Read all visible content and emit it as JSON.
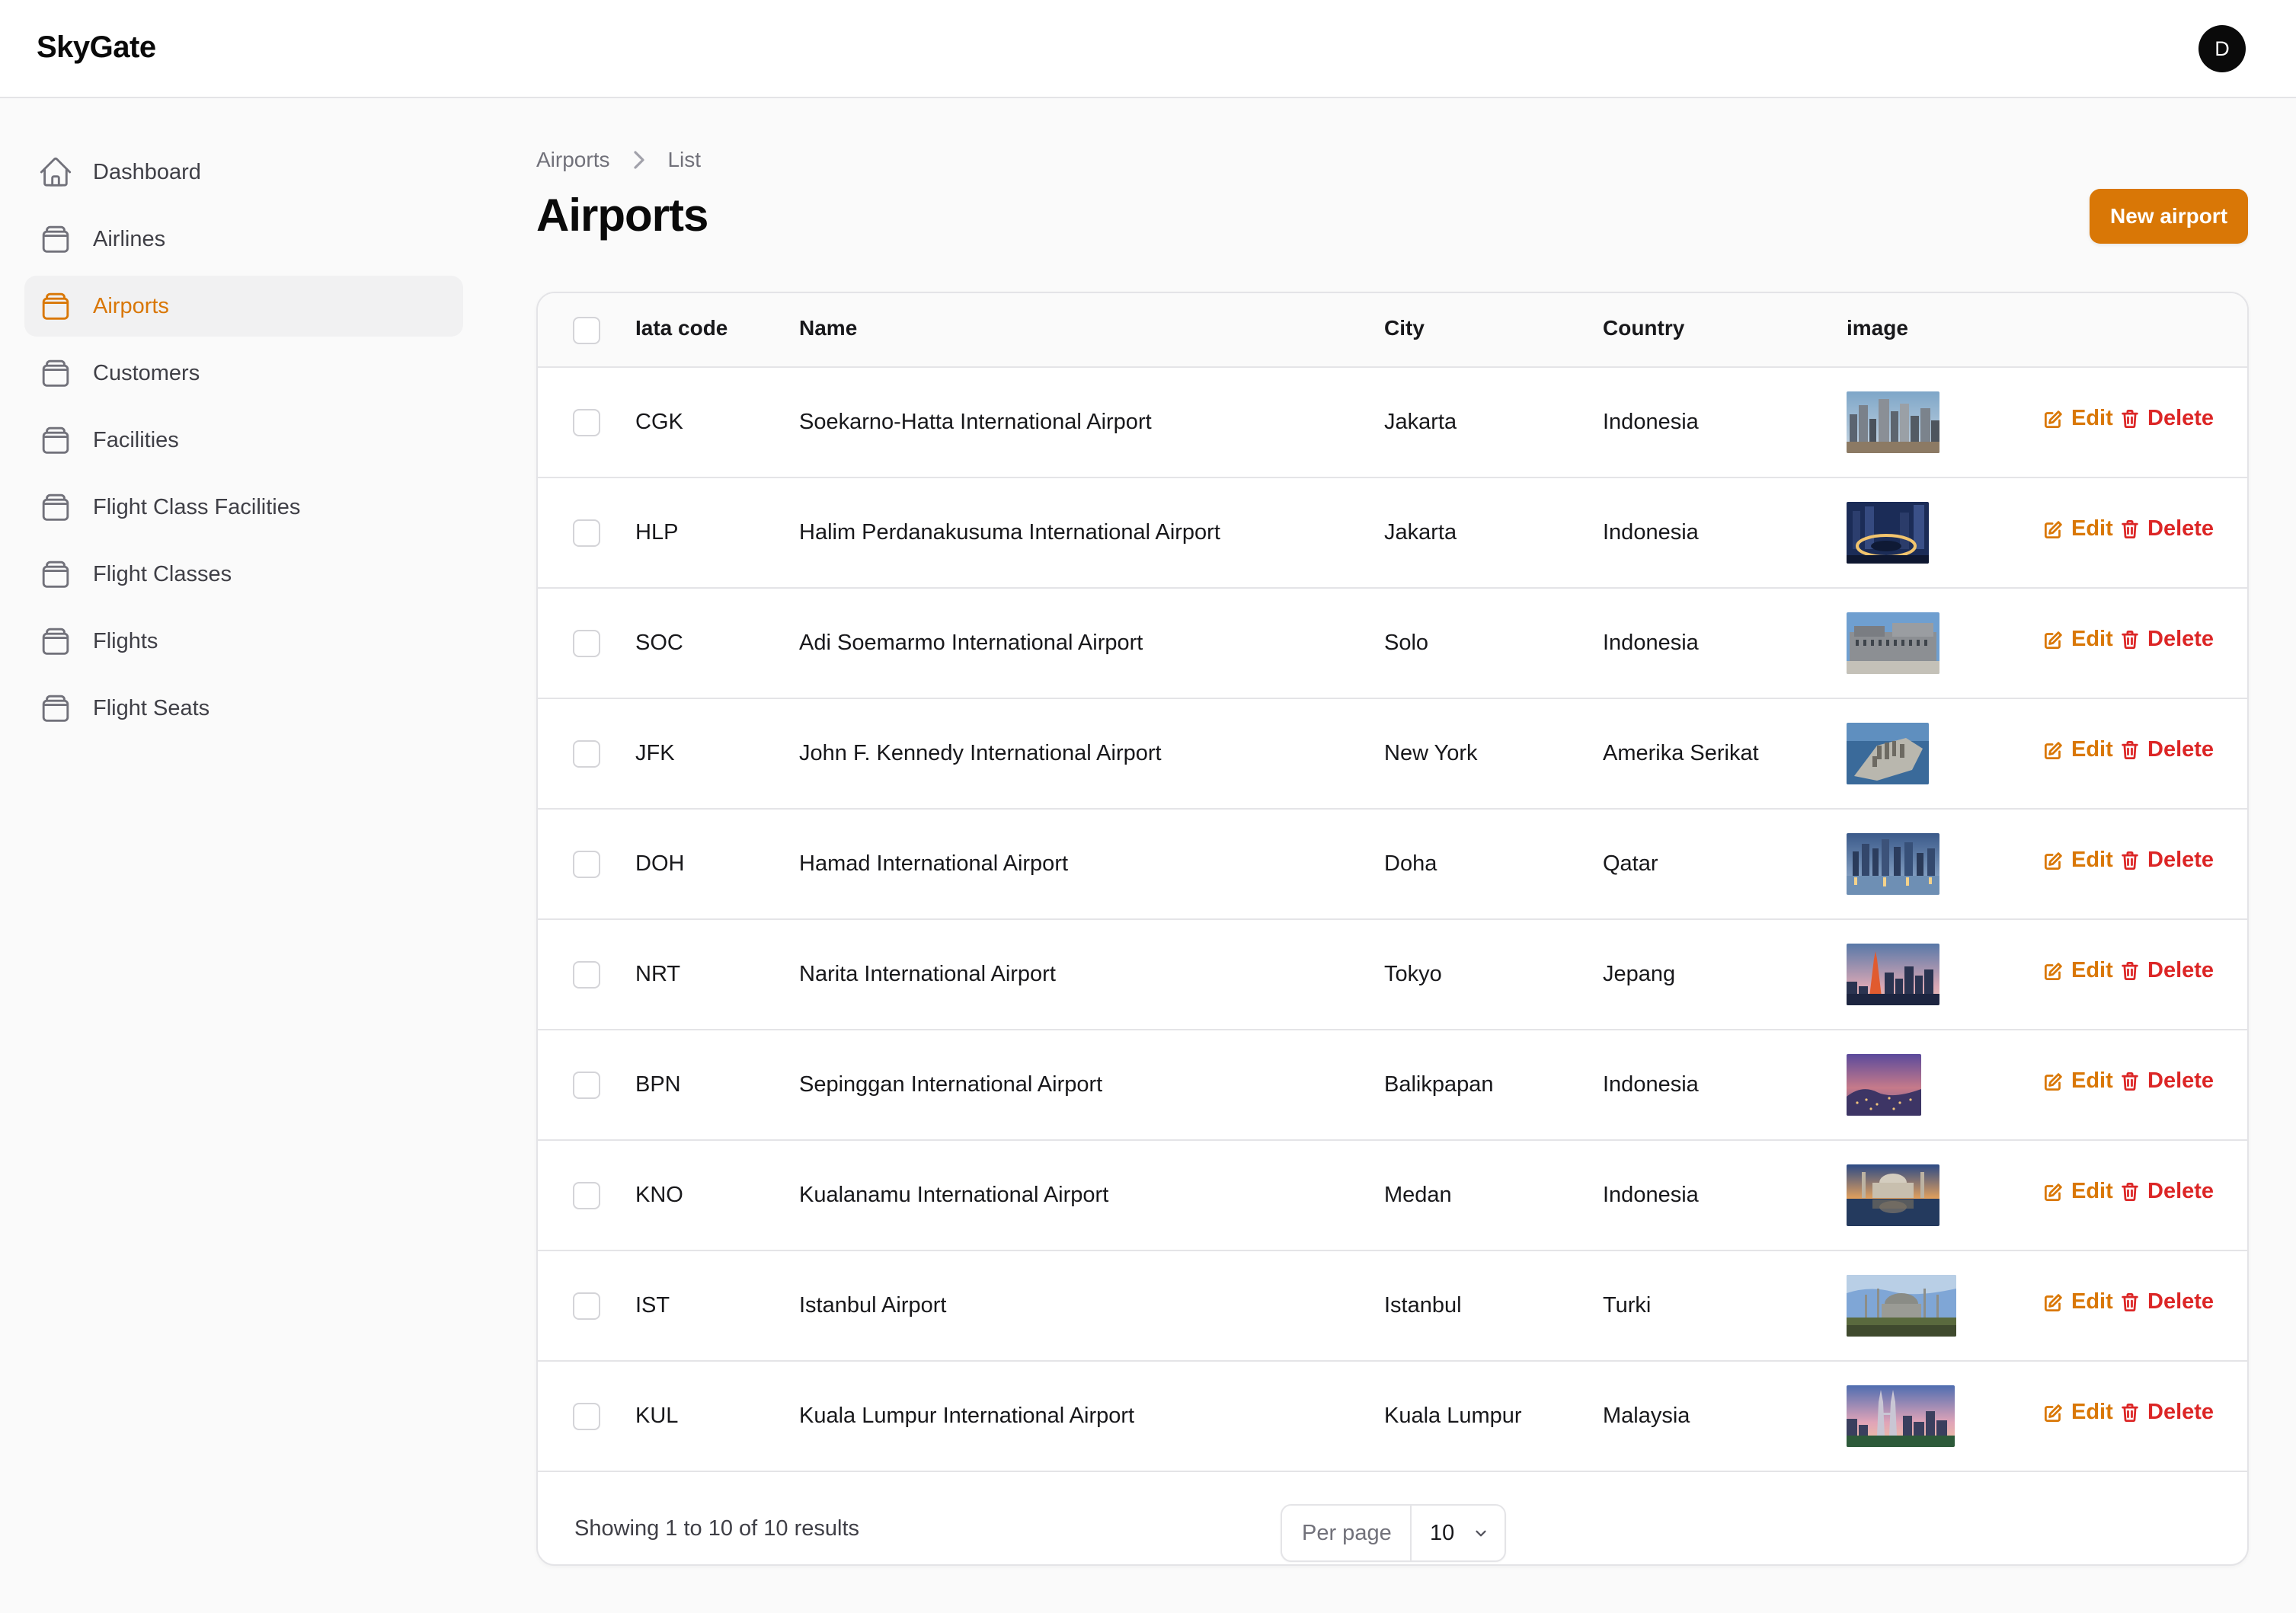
{
  "app": {
    "brand": "SkyGate",
    "user_initial": "D"
  },
  "sidebar": {
    "items": [
      {
        "label": "Dashboard",
        "icon": "home-icon",
        "active": false
      },
      {
        "label": "Airlines",
        "icon": "collection-icon",
        "active": false
      },
      {
        "label": "Airports",
        "icon": "collection-icon",
        "active": true
      },
      {
        "label": "Customers",
        "icon": "collection-icon",
        "active": false
      },
      {
        "label": "Facilities",
        "icon": "collection-icon",
        "active": false
      },
      {
        "label": "Flight Class Facilities",
        "icon": "collection-icon",
        "active": false
      },
      {
        "label": "Flight Classes",
        "icon": "collection-icon",
        "active": false
      },
      {
        "label": "Flights",
        "icon": "collection-icon",
        "active": false
      },
      {
        "label": "Flight Seats",
        "icon": "collection-icon",
        "active": false
      }
    ]
  },
  "breadcrumb": {
    "parent": "Airports",
    "current": "List"
  },
  "page": {
    "title": "Airports",
    "new_button": "New airport"
  },
  "table": {
    "columns": [
      "Iata code",
      "Name",
      "City",
      "Country",
      "image"
    ],
    "edit_label": "Edit",
    "delete_label": "Delete",
    "rows": [
      {
        "iata": "CGK",
        "name": "Soekarno-Hatta International Airport",
        "city": "Jakarta",
        "country": "Indonesia",
        "image": "city-skyline-day"
      },
      {
        "iata": "HLP",
        "name": "Halim Perdanakusuma International Airport",
        "city": "Jakarta",
        "country": "Indonesia",
        "image": "city-night-roundabout"
      },
      {
        "iata": "SOC",
        "name": "Adi Soemarmo International Airport",
        "city": "Solo",
        "country": "Indonesia",
        "image": "palace-building"
      },
      {
        "iata": "JFK",
        "name": "John F. Kennedy International Airport",
        "city": "New York",
        "country": "Amerika Serikat",
        "image": "manhattan-aerial"
      },
      {
        "iata": "DOH",
        "name": "Hamad International Airport",
        "city": "Doha",
        "country": "Qatar",
        "image": "doha-skyline-dusk"
      },
      {
        "iata": "NRT",
        "name": "Narita International Airport",
        "city": "Tokyo",
        "country": "Jepang",
        "image": "tokyo-tower-dusk"
      },
      {
        "iata": "BPN",
        "name": "Sepinggan International Airport",
        "city": "Balikpapan",
        "country": "Indonesia",
        "image": "city-sunset-purple"
      },
      {
        "iata": "KNO",
        "name": "Kualanamu International Airport",
        "city": "Medan",
        "country": "Indonesia",
        "image": "mosque-reflection"
      },
      {
        "iata": "IST",
        "name": "Istanbul Airport",
        "city": "Istanbul",
        "country": "Turki",
        "image": "istanbul-mosque"
      },
      {
        "iata": "KUL",
        "name": "Kuala Lumpur International Airport",
        "city": "Kuala Lumpur",
        "country": "Malaysia",
        "image": "petronas-towers"
      }
    ]
  },
  "footer": {
    "showing": "Showing 1 to 10 of 10 results",
    "per_page_label": "Per page",
    "per_page_value": "10"
  },
  "colors": {
    "accent": "#d97706",
    "danger": "#dc2626",
    "border": "#e4e4e7"
  }
}
